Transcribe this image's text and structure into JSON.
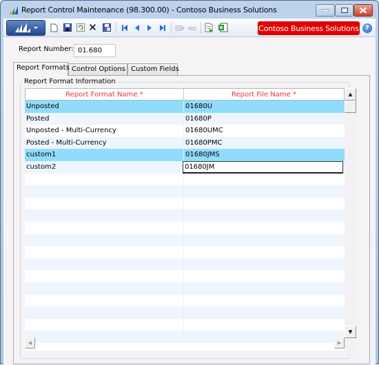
{
  "window": {
    "title": "Report Control Maintenance (98.300.00) - Contoso Business Solutions",
    "controls": {
      "minimize": "minimize",
      "maximize": "maximize",
      "close": "close"
    }
  },
  "toolbar": {
    "menu_button": "dynamics-menu",
    "icons": [
      "new-icon",
      "save-icon",
      "refresh-icon",
      "delete-icon",
      "save-close-icon",
      "first-icon",
      "previous-icon",
      "next-icon",
      "last-icon",
      "insert-row-icon",
      "delete-row-icon",
      "report-icon",
      "excel-icon"
    ],
    "company": "Contoso Business Solutions",
    "help": "?",
    "glyphs": {
      "delete": "✕",
      "first": "⏮",
      "prev": "◀",
      "next": "▶",
      "last": "⏭"
    }
  },
  "form": {
    "report_number_label": "Report Number:",
    "report_number_value": "01.680"
  },
  "tabs": [
    {
      "label": "Report Formats",
      "active": true
    },
    {
      "label": "Control Options",
      "active": false
    },
    {
      "label": "Custom Fields",
      "active": false
    }
  ],
  "group": {
    "label": "Report Format Information"
  },
  "grid": {
    "columns": [
      "Report Format Name *",
      "Report File Name *"
    ],
    "rows": [
      {
        "name": "Unposted",
        "file": "01680U",
        "selected": true
      },
      {
        "name": "Posted",
        "file": "01680P",
        "selected": false
      },
      {
        "name": "Unposted - Multi-Currency",
        "file": "01680UMC",
        "selected": false
      },
      {
        "name": "Posted - Multi-Currency",
        "file": "01680PMC",
        "selected": false
      },
      {
        "name": "custom1",
        "file": "01680JMS",
        "selected": true
      },
      {
        "name": "custom2",
        "file": "01680JM",
        "selected": false,
        "editing": true
      }
    ],
    "empty_rows": 14
  },
  "colors": {
    "brand": "#e00000",
    "header_text": "#e8323e",
    "selected_row": "#91dcfd",
    "alt_row": "#eef5fd"
  }
}
